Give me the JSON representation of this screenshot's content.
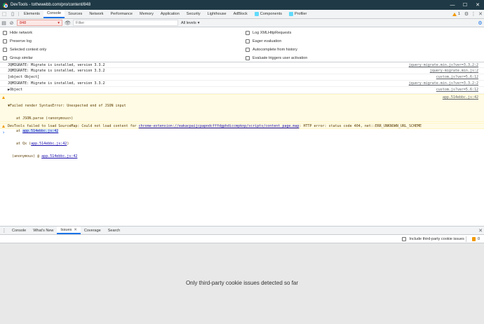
{
  "window": {
    "title": "DevTools - tothewebb.com/pro/content/848",
    "controls": [
      "—",
      "☐",
      "✕"
    ]
  },
  "tabs": {
    "items": [
      "Elements",
      "Console",
      "Sources",
      "Network",
      "Performance",
      "Memory",
      "Application",
      "Security",
      "Lighthouse",
      "AdBlock",
      "Components",
      "Profiler"
    ],
    "active": "Console",
    "warning_count": "1"
  },
  "console_toolbar": {
    "context": "848",
    "filter_placeholder": "Filter",
    "levels": "All levels"
  },
  "settings": {
    "left": [
      "Hide network",
      "Preserve log",
      "Selected context only",
      "Group similar"
    ],
    "right": [
      "Log XMLHttpRequests",
      "Eager evaluation",
      "Autocomplete from history",
      "Evaluate triggers user activation"
    ]
  },
  "messages": [
    {
      "text": "JQMIGRATE: Migrate is installed, version 3.3.2",
      "source": "jquery-migrate.min.js?ver=3.3.2:2"
    },
    {
      "text": "JQMIGRATE: Migrate is installed, version 3.3.2",
      "source": "jquery-migrate.min.js:2"
    },
    {
      "text": "[object Object]",
      "source": "custom.js?ver=5.6:12"
    },
    {
      "text": "JQMIGRATE: Migrate is installed, version 3.3.2",
      "source": "jquery-migrate.min.js?ver=3.3.2:2"
    },
    {
      "text": "▶Object",
      "source": "custom.js?ver=5.6:12"
    }
  ],
  "error_message": {
    "line1": "▼Failed render SyntaxError: Unexpected end of JSON input",
    "line2": "    at JSON.parse (<anonymous>)",
    "line3_prefix": "    at ",
    "line3_link": "app.514ebbc.js:42",
    "line4_prefix": "    at Qx (",
    "line4_link": "app.514ebbc.js:42",
    "line4_suffix": ")",
    "line5_prefix": "  (anonymous) @ ",
    "line5_link": "app.514ebbc.js:42",
    "source": "app.514ebbc.js:42"
  },
  "sourcemap_warning": {
    "prefix": "DevTools failed to load SourceMap: Could not load content for ",
    "link": "chrome-extension://eakacpaijcpapndcfffdgphdiccmpknp/scripts/content_page.map",
    "suffix": ": HTTP error: status code 404, net::ERR_UNKNOWN_URL_SCHEME"
  },
  "drawer": {
    "tabs": [
      "Console",
      "What's New",
      "Issues",
      "Coverage",
      "Search"
    ],
    "active": "Issues",
    "third_party_label": "Include third-party cookie issues",
    "issue_count": "0",
    "empty_text": "Only third-party cookie issues detected so far"
  }
}
